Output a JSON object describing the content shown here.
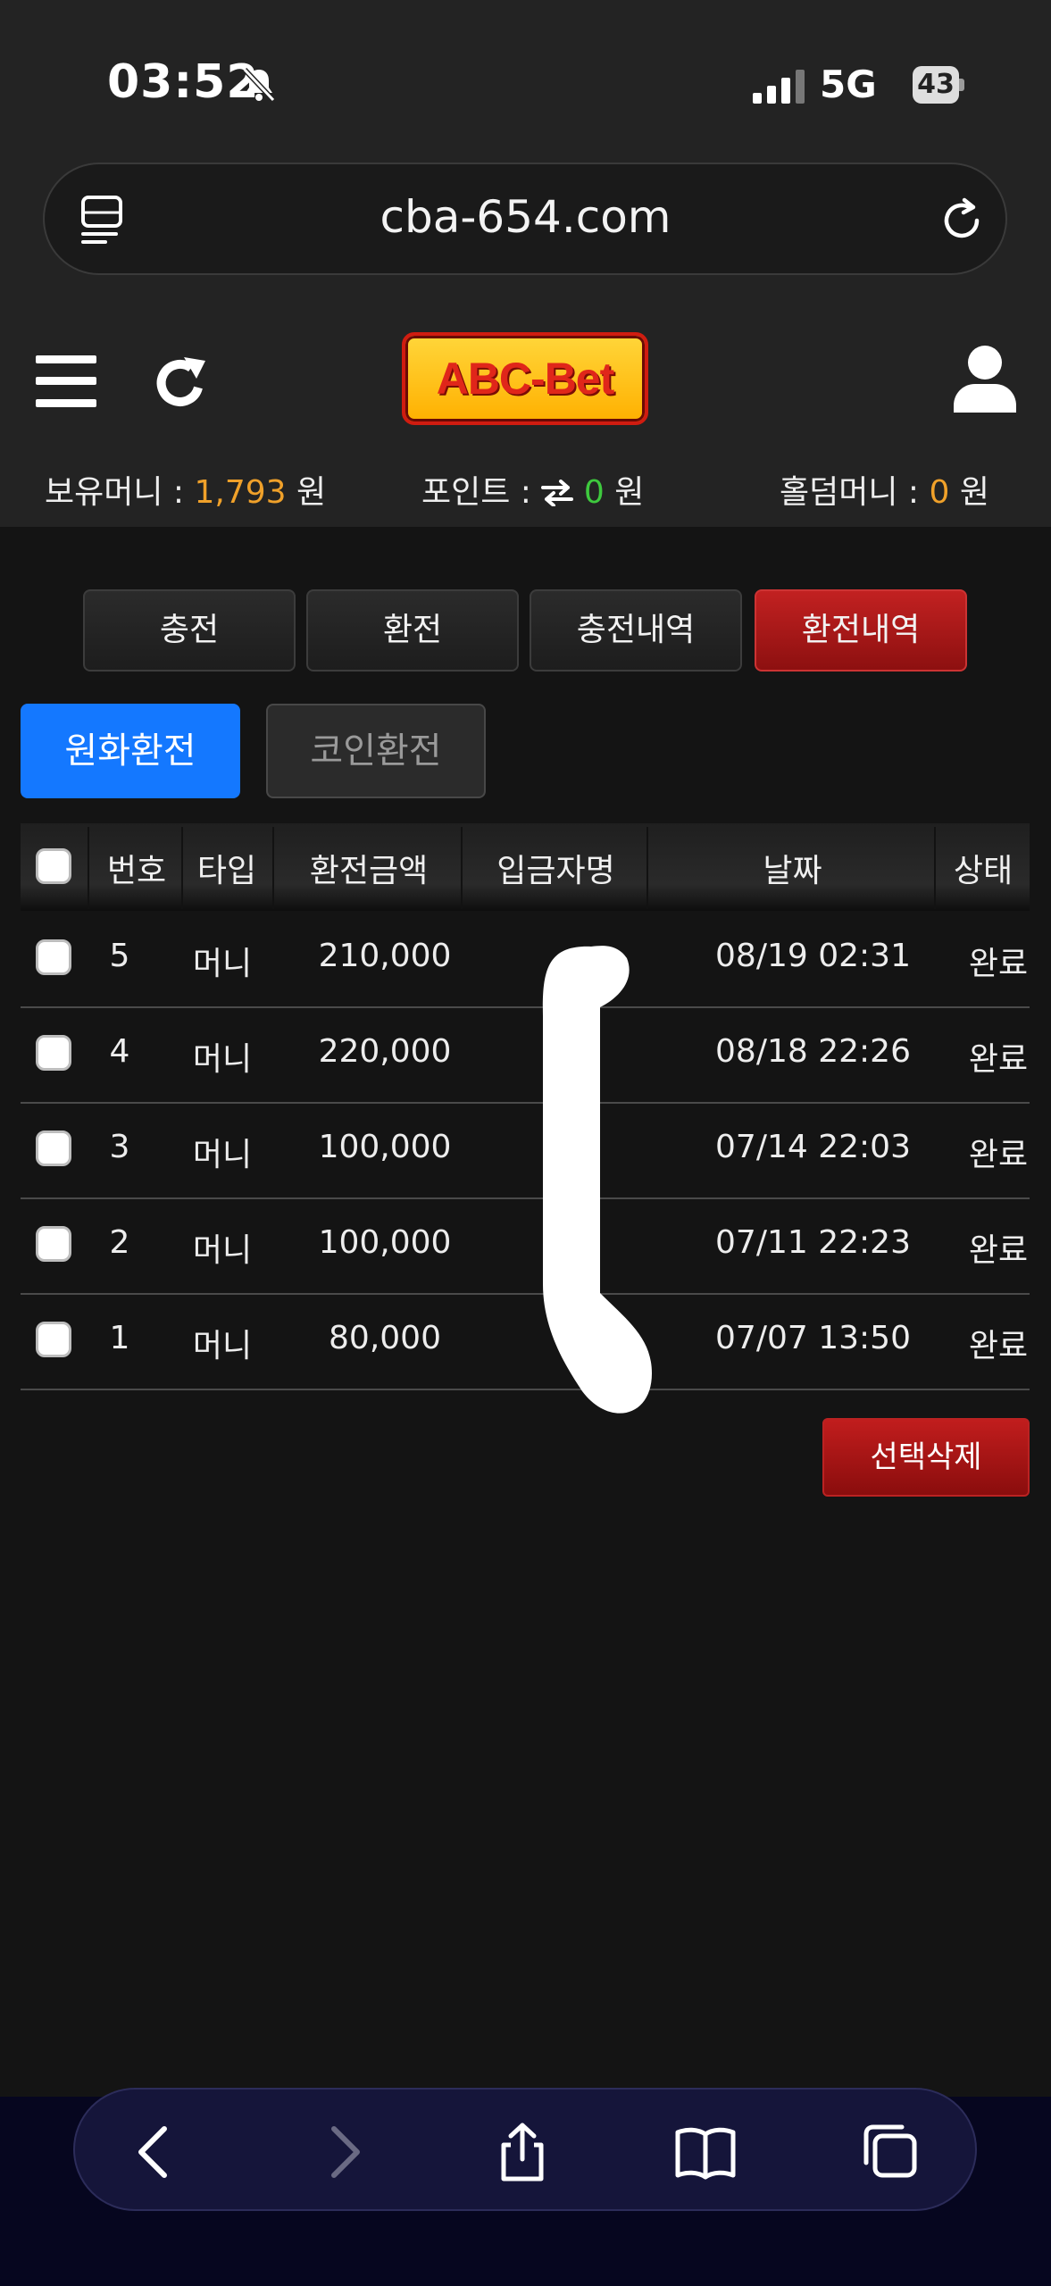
{
  "status_bar": {
    "time": "03:52",
    "network": "5G",
    "battery": "43"
  },
  "browser": {
    "url": "cba-654.com"
  },
  "header": {
    "logo_text": "ABC-Bet",
    "balances": {
      "money_label": "보유머니 : ",
      "money_value": "1,793",
      "money_unit": " 원",
      "point_label": "포인트 : ",
      "point_value": "0",
      "point_unit": " 원",
      "holdem_label": "홀덤머니 : ",
      "holdem_value": "0",
      "holdem_unit": " 원"
    }
  },
  "main_tabs": [
    {
      "label": "충전"
    },
    {
      "label": "환전"
    },
    {
      "label": "충전내역"
    },
    {
      "label": "환전내역",
      "active": true
    }
  ],
  "sub_tabs": [
    {
      "label": "원화환전",
      "active": true
    },
    {
      "label": "코인환전"
    }
  ],
  "table": {
    "headers": [
      "번호",
      "타입",
      "환전금액",
      "입금자명",
      "날짜",
      "상태"
    ],
    "rows": [
      {
        "no": "5",
        "type": "머니",
        "amount": "210,000",
        "name": "",
        "date": "08/19 02:31",
        "status": "완료"
      },
      {
        "no": "4",
        "type": "머니",
        "amount": "220,000",
        "name": "",
        "date": "08/18 22:26",
        "status": "완료"
      },
      {
        "no": "3",
        "type": "머니",
        "amount": "100,000",
        "name": "",
        "date": "07/14 22:03",
        "status": "완료"
      },
      {
        "no": "2",
        "type": "머니",
        "amount": "100,000",
        "name": "",
        "date": "07/11 22:23",
        "status": "완료"
      },
      {
        "no": "1",
        "type": "머니",
        "amount": "80,000",
        "name": "",
        "date": "07/07 13:50",
        "status": "완료"
      }
    ]
  },
  "delete_button": {
    "label": "선택삭제"
  },
  "colors": {
    "accent_blue": "#1478ff",
    "accent_red": "#b51818",
    "money_orange": "#f0a12a",
    "point_green": "#3ec93e"
  },
  "icons": [
    "bell-off-icon",
    "signal-icon",
    "page-menu-icon",
    "reload-icon",
    "hamburger-icon",
    "refresh-icon",
    "user-icon",
    "swap-icon",
    "back-icon",
    "forward-icon",
    "share-icon",
    "bookmarks-icon",
    "tabs-icon"
  ]
}
